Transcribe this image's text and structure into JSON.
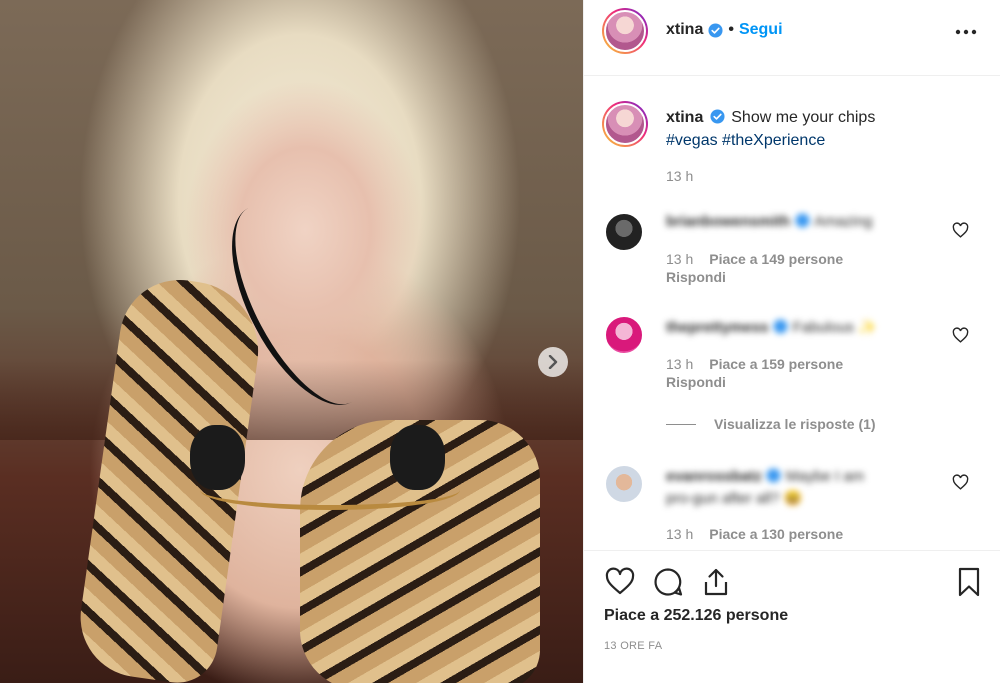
{
  "post": {
    "username": "xtina",
    "follow_label": "Segui",
    "caption": {
      "username": "xtina",
      "text": "Show me your chips",
      "hashtags": "#vegas #theXperience",
      "time": "13 h"
    }
  },
  "comments": [
    {
      "username": "brianbowensmith",
      "text": "Amazing",
      "time": "13 h",
      "likes": "Piace a 149 persone",
      "reply_label": "Rispondi"
    },
    {
      "username": "theprettymess",
      "text": "Fabulous ✨",
      "time": "13 h",
      "likes": "Piace a 159 persone",
      "reply_label": "Rispondi",
      "view_replies": "Visualizza le risposte (1)"
    },
    {
      "username": "evanrossbatz",
      "text_line1": "Maybe I am",
      "text_line2": "pro-gun after all? 😆",
      "time": "13 h",
      "likes": "Piace a 130 persone"
    }
  ],
  "footer": {
    "likes": "Piace a 252.126 persone",
    "posted": "13 ORE FA"
  },
  "colors": {
    "accent": "#0095f6",
    "hashtag": "#00376b",
    "secondary_text": "#8e8e8e",
    "border": "#efefef"
  },
  "icons": [
    "verified-badge-icon",
    "more-options-icon",
    "chevron-right-icon",
    "heart-icon",
    "comment-icon",
    "share-icon",
    "bookmark-icon"
  ]
}
